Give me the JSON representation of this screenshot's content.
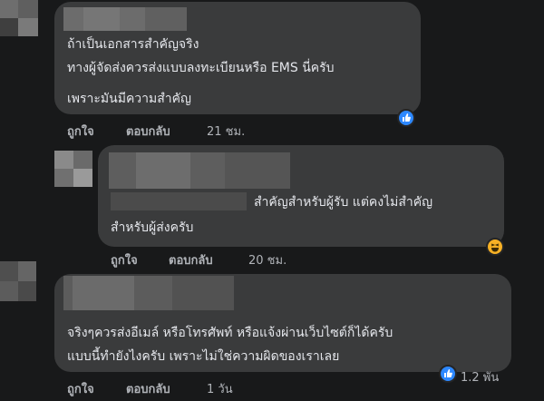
{
  "comments": [
    {
      "lines": [
        "ถ้าเป็นเอกสารสำคัญจริง",
        "ทางผู้จัดส่งควรส่งแบบลงทะเบียนหรือ EMS นี่ครับ",
        "เพราะมันมีความสำคัญ"
      ],
      "like_label": "ถูกใจ",
      "reply_label": "ตอบกลับ",
      "time": "21 ชม.",
      "reaction_icon": "like-icon",
      "reaction_color": "#2d88ff"
    },
    {
      "lines": [
        "สำคัญสำหรับผู้รับ แต่คงไม่สำคัญ",
        "สำหรับผู้ส่งครับ"
      ],
      "like_label": "ถูกใจ",
      "reply_label": "ตอบกลับ",
      "time": "20 ชม.",
      "reaction_icon": "haha-icon",
      "reaction_color": "#f7b125"
    },
    {
      "lines": [
        "จริงๆควรส่งอีเมล์ หรือโทรศัพท์ หรือแจ้งผ่านเว็บไซต์ก็ได้ครับ",
        "แบบนี้ทำยังไงครับ เพราะไม่ใช่ความผิดของเราเลย"
      ],
      "like_label": "ถูกใจ",
      "reply_label": "ตอบกลับ",
      "time": "1 วัน",
      "reaction_icon": "like-icon",
      "reaction_color": "#2d88ff",
      "reaction_count": "1.2 พัน"
    }
  ]
}
